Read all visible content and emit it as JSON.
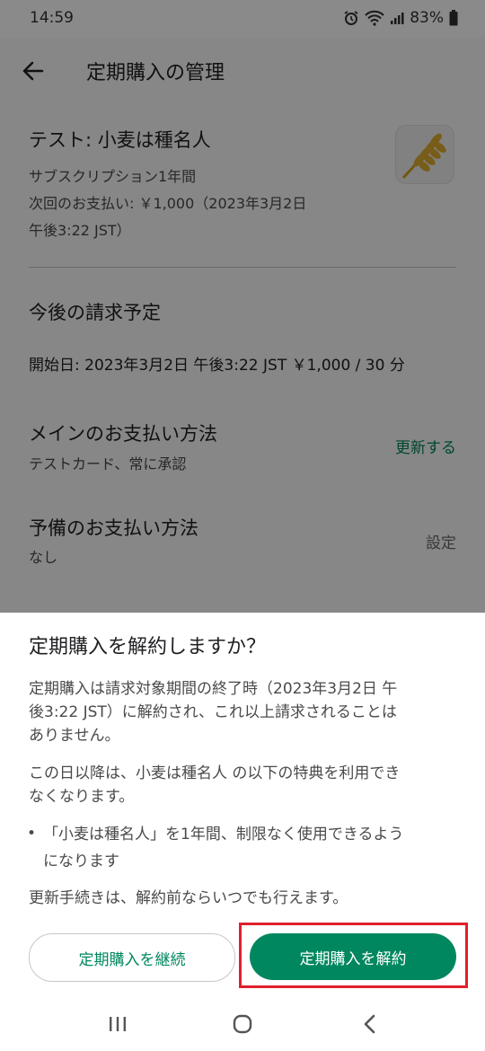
{
  "status_bar": {
    "time": "14:59",
    "battery": "83%",
    "icons": [
      "alarm-icon",
      "wifi-icon",
      "signal-icon",
      "battery-icon"
    ]
  },
  "header": {
    "title": "定期購入の管理"
  },
  "subscription": {
    "name": "テスト: 小麦は種名人",
    "period": "サブスクリプション1年間",
    "next_payment_line1": "次回のお支払い: ￥1,000（2023年3月2日",
    "next_payment_line2": "午後3:22 JST）"
  },
  "billing": {
    "title": "今後の請求予定",
    "start_line": "開始日: 2023年3月2日 午後3:22 JST  ￥1,000 / 30 分"
  },
  "payment_main": {
    "title": "メインのお支払い方法",
    "value": "テストカード、常に承認",
    "action": "更新する"
  },
  "payment_backup": {
    "title": "予備のお支払い方法",
    "value": "なし",
    "action": "設定"
  },
  "dialog": {
    "title": "定期購入を解約しますか？",
    "para1_line1": "定期購入は請求対象期間の終了時（2023年3月2日 午",
    "para1_line2": "後3:22 JST）に解約され、これ以上請求されることは",
    "para1_line3": "ありません。",
    "para2_line1": "この日以降は、小麦は種名人 の以下の特典を利用でき",
    "para2_line2": "なくなります。",
    "bullet": "•",
    "benefit_line1": "「小麦は種名人」を1年間、制限なく使用できるよう",
    "benefit_line2": "になります",
    "para3": "更新手続きは、解約前ならいつでも行えます。",
    "continue_button": "定期購入を継続",
    "cancel_button": "定期購入を解約"
  },
  "colors": {
    "accent_green": "#01875f",
    "highlight_red": "#e0202c",
    "scrim": "#000000"
  },
  "nav_bar": {
    "icons": [
      "recent-apps-icon",
      "home-icon",
      "back-nav-icon"
    ]
  }
}
